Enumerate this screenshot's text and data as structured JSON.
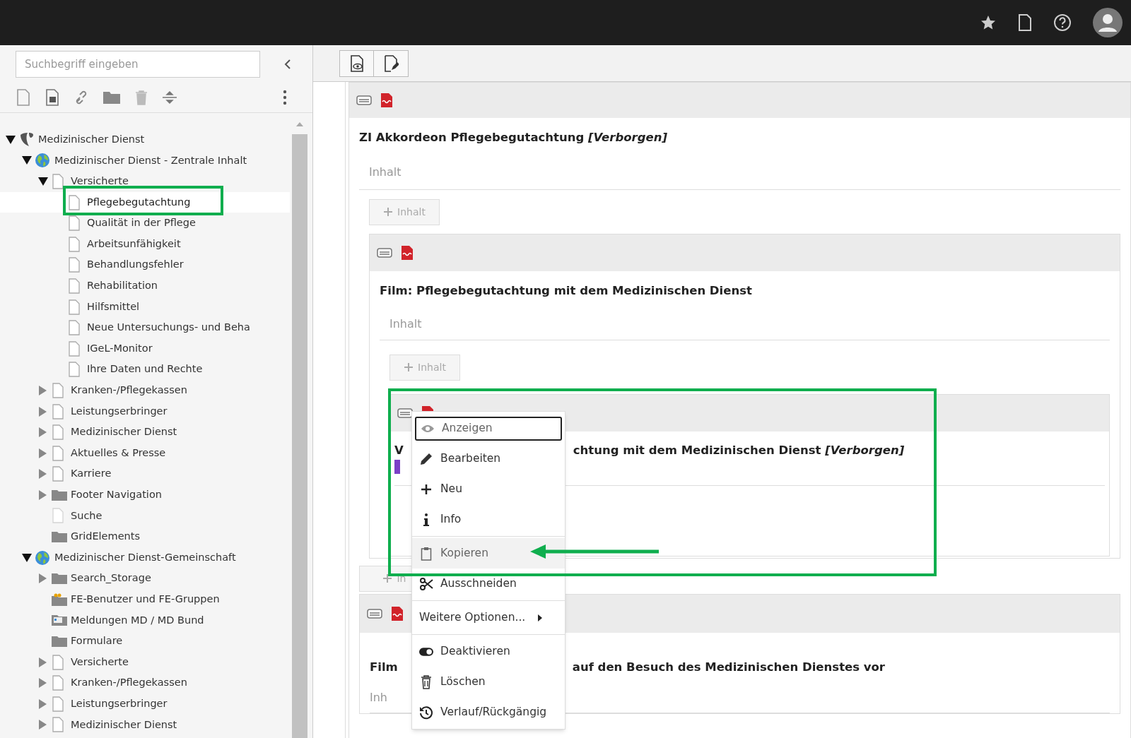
{
  "sidebar": {
    "search": {
      "placeholder": "Suchbegriff eingeben"
    },
    "tree": [
      {
        "label": "Medizinischer Dienst",
        "kind": "site-root",
        "expanded": true,
        "selected": false,
        "children": [
          {
            "label": "Medizinischer Dienst - Zentrale Inhalt",
            "kind": "globe",
            "expanded": true,
            "selected": false,
            "children": [
              {
                "label": "Versicherte",
                "kind": "page",
                "expanded": true,
                "selected": false,
                "children": [
                  {
                    "label": "Pflegebegutachtung",
                    "kind": "page",
                    "selected": true
                  },
                  {
                    "label": "Qualität in der Pflege",
                    "kind": "page",
                    "selected": false
                  },
                  {
                    "label": "Arbeitsunfähigkeit",
                    "kind": "page",
                    "selected": false
                  },
                  {
                    "label": "Behandlungsfehler",
                    "kind": "page",
                    "selected": false
                  },
                  {
                    "label": "Rehabilitation",
                    "kind": "page",
                    "selected": false
                  },
                  {
                    "label": "Hilfsmittel",
                    "kind": "page",
                    "selected": false
                  },
                  {
                    "label": "Neue Untersuchungs- und Beha",
                    "kind": "page",
                    "selected": false
                  },
                  {
                    "label": "IGeL-Monitor",
                    "kind": "page",
                    "selected": false
                  },
                  {
                    "label": "Ihre Daten und Rechte",
                    "kind": "page",
                    "selected": false
                  }
                ]
              },
              {
                "label": "Kranken-/Pflegekassen",
                "kind": "page",
                "expanded": false,
                "selected": false
              },
              {
                "label": "Leistungserbringer",
                "kind": "page",
                "expanded": false,
                "selected": false
              },
              {
                "label": "Medizinischer Dienst",
                "kind": "page",
                "expanded": false,
                "selected": false
              },
              {
                "label": "Aktuelles & Presse",
                "kind": "page",
                "expanded": false,
                "selected": false
              },
              {
                "label": "Karriere",
                "kind": "page",
                "expanded": false,
                "selected": false
              },
              {
                "label": "Footer Navigation",
                "kind": "folder",
                "expanded": false,
                "selected": false
              },
              {
                "label": "Suche",
                "kind": "page-faint",
                "selected": false
              },
              {
                "label": "GridElements",
                "kind": "folder",
                "selected": false
              }
            ]
          },
          {
            "label": "Medizinischer Dienst-Gemeinschaft",
            "kind": "globe",
            "expanded": true,
            "selected": false,
            "children": [
              {
                "label": "Search_Storage",
                "kind": "folder",
                "expanded": false,
                "selected": false
              },
              {
                "label": "FE-Benutzer und FE-Gruppen",
                "kind": "folder-users",
                "selected": false
              },
              {
                "label": "Meldungen MD / MD Bund",
                "kind": "folder-news",
                "selected": false
              },
              {
                "label": "Formulare",
                "kind": "folder",
                "selected": false
              },
              {
                "label": "Versicherte",
                "kind": "page",
                "expanded": false,
                "selected": false
              },
              {
                "label": "Kranken-/Pflegekassen",
                "kind": "page",
                "expanded": false,
                "selected": false
              },
              {
                "label": "Leistungserbringer",
                "kind": "page",
                "expanded": false,
                "selected": false
              },
              {
                "label": "Medizinischer Dienst",
                "kind": "page",
                "expanded": false,
                "selected": false
              }
            ]
          }
        ]
      }
    ]
  },
  "content": {
    "card_1": {
      "title": "ZI Akkordeon Pflegebegutachtung *[Verborgen]*",
      "column_label": "Inhalt",
      "add_button": "Inhalt"
    },
    "card_2": {
      "title": "Film: Pflegebegutachtung mit dem Medizinischen Dienst",
      "column_label": "Inhalt",
      "add_button": "Inhalt"
    },
    "card_3": {
      "title_start": "V",
      "title_end": "chtung mit dem Medizinischen Dienst *[Verborgen]*"
    },
    "card_2_after_button": "In",
    "card_4": {
      "title_start": "Film",
      "title_end": "auf den Besuch des Medizinischen Dienstes vor",
      "column_label": "Inh"
    }
  },
  "context_menu": {
    "groups": [
      [
        {
          "label": "Anzeigen",
          "kind": "eye",
          "focused": true,
          "hovered": false
        },
        {
          "label": "Bearbeiten",
          "kind": "pencil",
          "focused": false,
          "hovered": false
        },
        {
          "label": "Neu",
          "kind": "plus",
          "focused": false,
          "hovered": false
        },
        {
          "label": "Info",
          "kind": "info",
          "focused": false,
          "hovered": false
        }
      ],
      [
        {
          "label": "Kopieren",
          "kind": "clipboard",
          "focused": false,
          "hovered": true
        },
        {
          "label": "Ausschneiden",
          "kind": "scissors",
          "focused": false,
          "hovered": false
        }
      ],
      [
        {
          "label": "Weitere Optionen...",
          "kind": "submenu",
          "submenu": true,
          "focused": false,
          "hovered": false
        }
      ],
      [
        {
          "label": "Deaktivieren",
          "kind": "toggle",
          "focused": false,
          "hovered": false
        },
        {
          "label": "Löschen",
          "kind": "trash",
          "focused": false,
          "hovered": false
        },
        {
          "label": "Verlauf/Rückgängig",
          "kind": "history",
          "focused": false,
          "hovered": false
        }
      ]
    ]
  }
}
